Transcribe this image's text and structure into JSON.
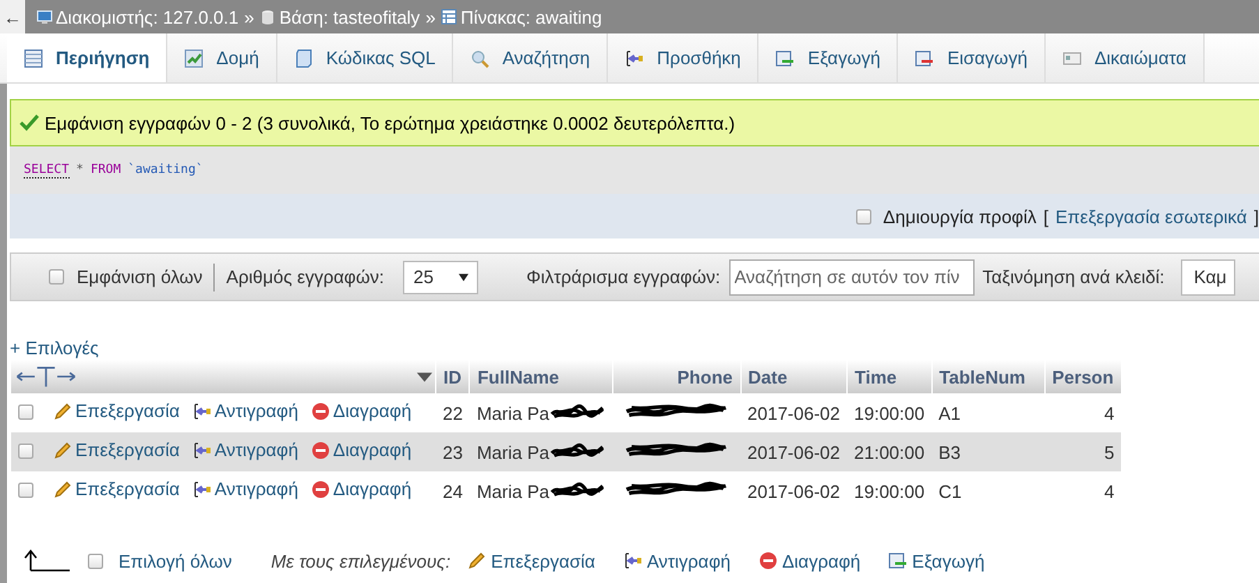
{
  "back_arrow": "←",
  "breadcrumb": [
    {
      "kind": "server",
      "label": "Διακομιστής: 127.0.0.1",
      "separator": "»"
    },
    {
      "kind": "database",
      "label": "Βάση: tasteofitaly",
      "separator": "»"
    },
    {
      "kind": "table",
      "label": "Πίνακας: awaiting"
    }
  ],
  "tabs": [
    {
      "label": "Περιήγηση",
      "kind": "browse",
      "selected": true
    },
    {
      "label": "Δομή",
      "kind": "structure",
      "selected": false
    },
    {
      "label": "Κώδικας SQL",
      "kind": "sql",
      "selected": false
    },
    {
      "label": "Αναζήτηση",
      "kind": "search",
      "selected": false
    },
    {
      "label": "Προσθήκη",
      "kind": "insert",
      "selected": false
    },
    {
      "label": "Εξαγωγή",
      "kind": "export",
      "selected": false
    },
    {
      "label": "Εισαγωγή",
      "kind": "import",
      "selected": false
    },
    {
      "label": "Δικαιώματα",
      "kind": "privileges",
      "selected": false
    }
  ],
  "message": "Εμφάνιση εγγραφών 0 - 2 (3 συνολικά, Το ερώτημα χρειάστηκε 0.0002 δευτερόλεπτα.)",
  "sql": [
    {
      "kind": "keyword",
      "text": "SELECT"
    },
    {
      "kind": "plain",
      "text": "*"
    },
    {
      "kind": "keyword",
      "text": "FROM"
    },
    {
      "kind": "identifier",
      "text": "`awaiting`"
    }
  ],
  "profiling": {
    "label": "Δημιουργία προφίλ",
    "checked": false,
    "bracket_open": "[",
    "link": "Επεξεργασία εσωτερικά",
    "bracket_close": "]"
  },
  "navigation": {
    "show_all": {
      "label": "Εμφάνιση όλων",
      "checked": false
    },
    "rows_label": "Αριθμός εγγραφών:",
    "rows_value": "25",
    "filter_label": "Φιλτράρισμα εγγραφών:",
    "filter_placeholder": "Αναζήτηση σε αυτόν τον πίν",
    "sort_label": "Ταξινόμηση ανά κλειδί:",
    "sort_value": "Καμ"
  },
  "options_link": "+ Επιλογές",
  "table": {
    "columns": [
      "ID",
      "FullName",
      "Phone",
      "Date",
      "Time",
      "TableNum",
      "Person"
    ],
    "rows": [
      {
        "checked": false,
        "actions": [
          {
            "kind": "edit",
            "label": "Επεξεργασία"
          },
          {
            "kind": "copy",
            "label": "Αντιγραφή"
          },
          {
            "kind": "delete",
            "label": "Διαγραφή"
          }
        ],
        "id": "22",
        "fullname": "Maria Pa",
        "name_redacted": true,
        "phone_redacted": true,
        "date": "2017-06-02",
        "time": "19:00:00",
        "table_num": "A1",
        "person": "4"
      },
      {
        "checked": false,
        "actions": [
          {
            "kind": "edit",
            "label": "Επεξεργασία"
          },
          {
            "kind": "copy",
            "label": "Αντιγραφή"
          },
          {
            "kind": "delete",
            "label": "Διαγραφή"
          }
        ],
        "id": "23",
        "fullname": "Maria Pa",
        "name_redacted": true,
        "phone_redacted": true,
        "date": "2017-06-02",
        "time": "21:00:00",
        "table_num": "B3",
        "person": "5"
      },
      {
        "checked": false,
        "actions": [
          {
            "kind": "edit",
            "label": "Επεξεργασία"
          },
          {
            "kind": "copy",
            "label": "Αντιγραφή"
          },
          {
            "kind": "delete",
            "label": "Διαγραφή"
          }
        ],
        "id": "24",
        "fullname": "Maria Pa",
        "name_redacted": true,
        "phone_redacted": true,
        "date": "2017-06-02",
        "time": "19:00:00",
        "table_num": "C1",
        "person": "4"
      }
    ]
  },
  "footer": {
    "select_all": {
      "label": "Επιλογή όλων",
      "checked": false
    },
    "with_selected": "Με τους επιλεγμένους:",
    "actions": [
      {
        "kind": "edit",
        "label": "Επεξεργασία"
      },
      {
        "kind": "copy",
        "label": "Αντιγραφή"
      },
      {
        "kind": "delete",
        "label": "Διαγραφή"
      },
      {
        "kind": "export",
        "label": "Εξαγωγή"
      }
    ]
  }
}
